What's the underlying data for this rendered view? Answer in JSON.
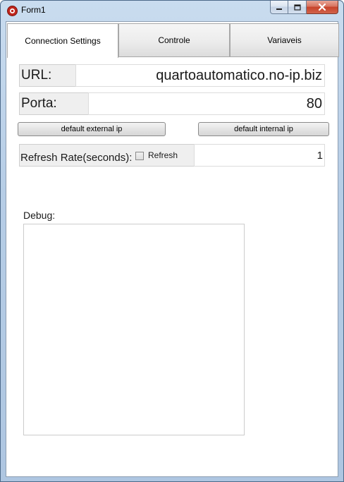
{
  "window": {
    "title": "Form1"
  },
  "tabs": [
    {
      "label": "Connection Settings",
      "active": true
    },
    {
      "label": "Controle",
      "active": false
    },
    {
      "label": "Variaveis",
      "active": false
    }
  ],
  "connection": {
    "url_label": "URL:",
    "url_value": "quartoautomatico.no-ip.biz",
    "port_label": "Porta:",
    "port_value": "80",
    "default_external_label": "default external ip",
    "default_internal_label": "default internal ip",
    "refresh_rate_label": "Refresh Rate(seconds):",
    "refresh_checkbox_label": "Refresh",
    "refresh_checked": false,
    "refresh_value": "1",
    "debug_label": "Debug:",
    "debug_text": ""
  },
  "colors": {
    "titlebar": "#b6cde6",
    "close_button": "#c7432a",
    "field_label_bg": "#efefef"
  }
}
